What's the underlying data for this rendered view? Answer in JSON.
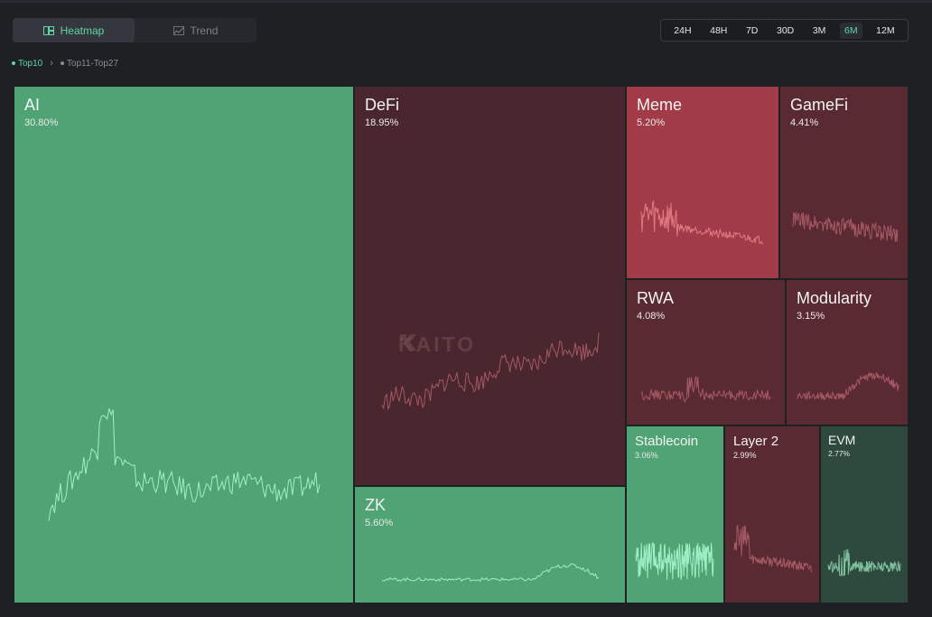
{
  "view_tabs": [
    {
      "label": "Heatmap",
      "icon": "heatmap-icon",
      "active": true
    },
    {
      "label": "Trend",
      "icon": "trend-icon",
      "active": false
    }
  ],
  "time_ranges": [
    {
      "label": "24H",
      "active": false
    },
    {
      "label": "48H",
      "active": false
    },
    {
      "label": "7D",
      "active": false
    },
    {
      "label": "30D",
      "active": false
    },
    {
      "label": "3M",
      "active": false
    },
    {
      "label": "6M",
      "active": true
    },
    {
      "label": "12M",
      "active": false
    }
  ],
  "breadcrumb": {
    "first": "Top10",
    "second": "Top11-Top27"
  },
  "watermark": "KAITO",
  "colors": {
    "green": "#50a375",
    "dark_red": "#4a272f",
    "red": "#a03b47",
    "mid_red": "#5a2a33",
    "evm_green": "#2e4a3f",
    "accent": "#5fd6a4"
  },
  "tiles": [
    {
      "id": "ai",
      "name": "AI",
      "pct": "30.80%",
      "color": "green"
    },
    {
      "id": "defi",
      "name": "DeFi",
      "pct": "18.95%",
      "color": "dark_red"
    },
    {
      "id": "zk",
      "name": "ZK",
      "pct": "5.60%",
      "color": "green"
    },
    {
      "id": "meme",
      "name": "Meme",
      "pct": "5.20%",
      "color": "red"
    },
    {
      "id": "gamefi",
      "name": "GameFi",
      "pct": "4.41%",
      "color": "mid_red"
    },
    {
      "id": "rwa",
      "name": "RWA",
      "pct": "4.08%",
      "color": "mid_red"
    },
    {
      "id": "modularity",
      "name": "Modularity",
      "pct": "3.15%",
      "color": "mid_red"
    },
    {
      "id": "stablecoin",
      "name": "Stablecoin",
      "pct": "3.06%",
      "color": "green"
    },
    {
      "id": "layer2",
      "name": "Layer 2",
      "pct": "2.99%",
      "color": "mid_red"
    },
    {
      "id": "evm",
      "name": "EVM",
      "pct": "2.77%",
      "color": "evm_green"
    }
  ]
}
